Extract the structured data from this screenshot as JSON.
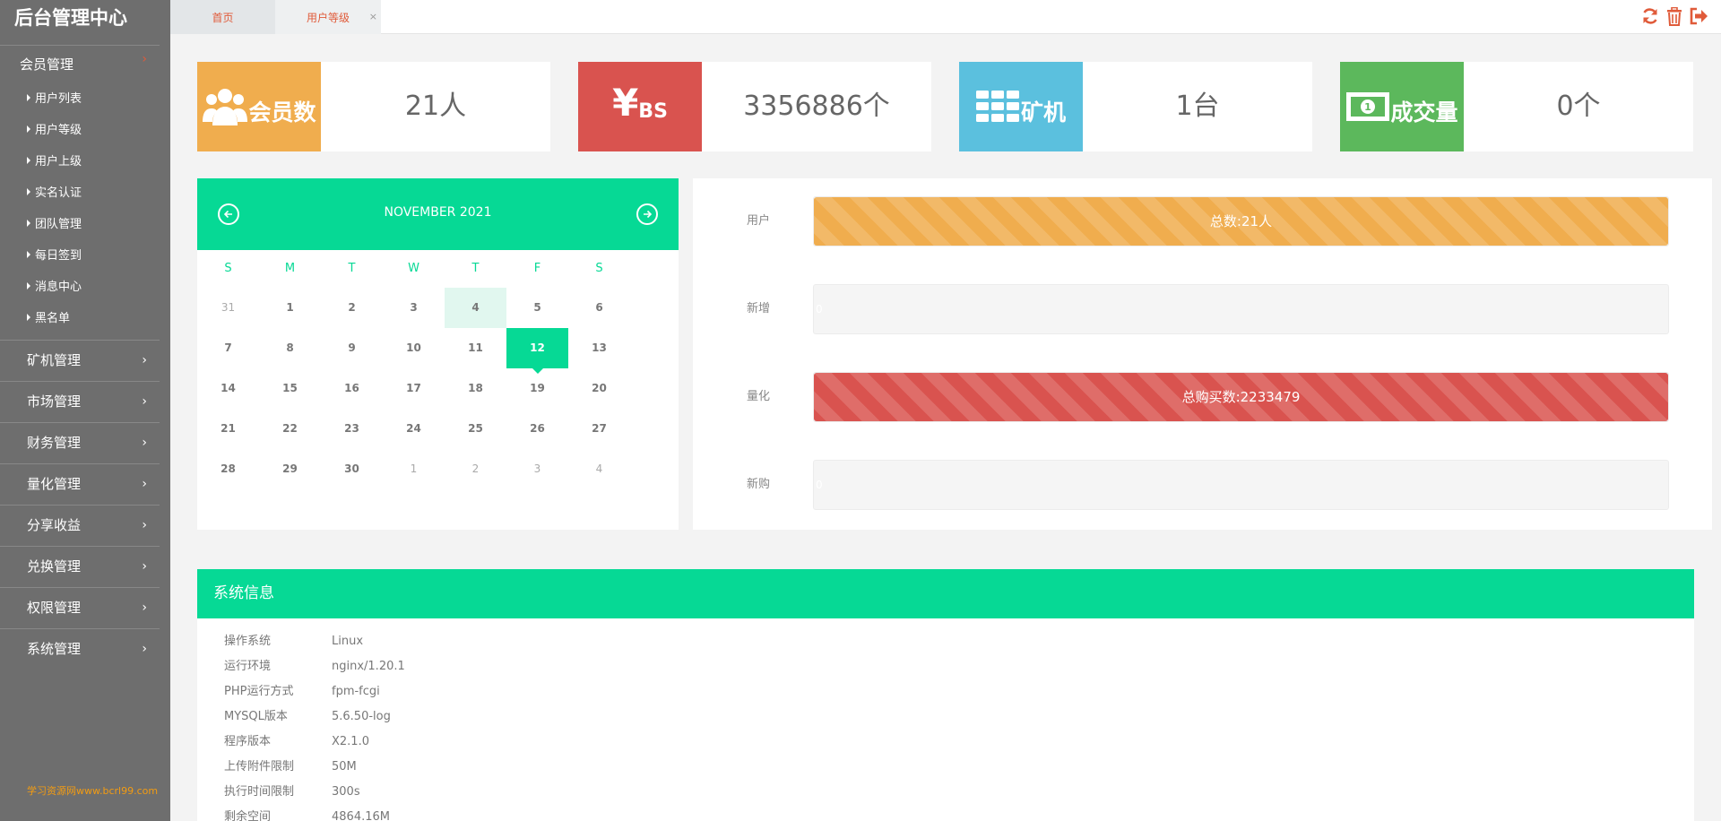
{
  "brand": "后台管理中心",
  "watermark": "学习资源网www.bcrl99.com",
  "sidebar": {
    "groups": [
      {
        "label": "会员管理",
        "items": [
          "用户列表",
          "用户等级",
          "用户上级",
          "实名认证",
          "团队管理",
          "每日签到",
          "消息中心",
          "黑名单"
        ]
      },
      {
        "label": "矿机管理"
      },
      {
        "label": "市场管理"
      },
      {
        "label": "财务管理"
      },
      {
        "label": "量化管理"
      },
      {
        "label": "分享收益"
      },
      {
        "label": "兑换管理"
      },
      {
        "label": "权限管理"
      },
      {
        "label": "系统管理"
      }
    ]
  },
  "tabs": [
    {
      "label": "首页"
    },
    {
      "label": "用户等级",
      "close": "×"
    }
  ],
  "stats": [
    {
      "label": "会员数",
      "value": "21人",
      "color": "#f0ad4e",
      "icon": "users-icon"
    },
    {
      "label": "BS",
      "symbol": "¥",
      "value": "3356886个",
      "color": "#d9534f",
      "icon": "yen-icon"
    },
    {
      "label": "矿机",
      "value": "1台",
      "color": "#5bc0de",
      "icon": "grid-icon"
    },
    {
      "label": "成交量",
      "value": "0个",
      "color": "#5cb85c",
      "icon": "money-icon"
    }
  ],
  "calendar": {
    "title": "NOVEMBER 2021",
    "dow": [
      "S",
      "M",
      "T",
      "W",
      "T",
      "F",
      "S"
    ],
    "weeks": [
      [
        "31",
        "1",
        "2",
        "3",
        "4",
        "5",
        "6"
      ],
      [
        "7",
        "8",
        "9",
        "10",
        "11",
        "12",
        "13"
      ],
      [
        "14",
        "15",
        "16",
        "17",
        "18",
        "19",
        "20"
      ],
      [
        "21",
        "22",
        "23",
        "24",
        "25",
        "26",
        "27"
      ],
      [
        "28",
        "29",
        "30",
        "1",
        "2",
        "3",
        "4"
      ]
    ],
    "today": "4",
    "selected": "12",
    "accent": "#06d995"
  },
  "progress": [
    {
      "label": "用户",
      "text": "总数:21人",
      "fraction": 1.0,
      "color": "orange"
    },
    {
      "label": "新增",
      "text": "0",
      "fraction": 0.0,
      "color": "none"
    },
    {
      "label": "量化",
      "text": "总购买数:2233479",
      "fraction": 1.0,
      "color": "red"
    },
    {
      "label": "新购",
      "text": "0",
      "fraction": 0.0,
      "color": "none"
    }
  ],
  "sysinfo": {
    "title": "系统信息",
    "rows": [
      {
        "k": "操作系统",
        "v": "Linux"
      },
      {
        "k": "运行环境",
        "v": "nginx/1.20.1"
      },
      {
        "k": "PHP运行方式",
        "v": "fpm-fcgi"
      },
      {
        "k": "MYSQL版本",
        "v": "5.6.50-log"
      },
      {
        "k": "程序版本",
        "v": "X2.1.0"
      },
      {
        "k": "上传附件限制",
        "v": "50M"
      },
      {
        "k": "执行时间限制",
        "v": "300s"
      },
      {
        "k": "剩余空间",
        "v": "4864.16M"
      }
    ]
  }
}
